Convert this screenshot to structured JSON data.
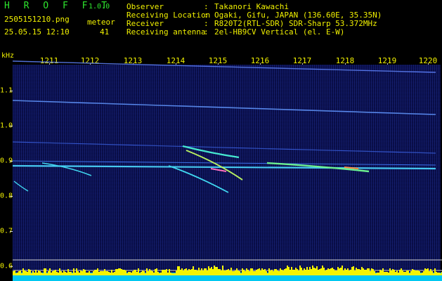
{
  "app": {
    "title": "H R O F F T",
    "version": "1.0.0"
  },
  "file": {
    "name": "2505151210.png",
    "datetime": "25.05.15 12:10"
  },
  "meteor": {
    "label": "meteor",
    "count": "41"
  },
  "station": {
    "observer_key": "Observer",
    "observer_val": "Takanori Kawachi",
    "location_key": "Receiving Location",
    "location_val": "Ogaki, Gifu, JAPAN (136.60E, 35.35N)",
    "receiver_key": "Receiver",
    "receiver_val": "R820T2(RTL-SDR) SDR-Sharp 53.372MHz",
    "antenna_key": "Receiving antenna",
    "antenna_val": "2el-HB9CV Vertical (el. E-W)",
    "colon": ":"
  },
  "axis": {
    "unit": "kHz",
    "time_ticks": [
      "1211",
      "1212",
      "1213",
      "1214",
      "1215",
      "1216",
      "1217",
      "1218",
      "1219",
      "1220"
    ],
    "freq_ticks": [
      "1.1",
      "1.0",
      "0.9",
      "0.8",
      "0.7",
      "0.6"
    ]
  },
  "colors": {
    "label": "#f0f000",
    "header_green": "#2ee62e",
    "background_noise": "#06093a",
    "baseline_fill": "#f4f400",
    "noise_floor": "#00c8f0"
  }
}
